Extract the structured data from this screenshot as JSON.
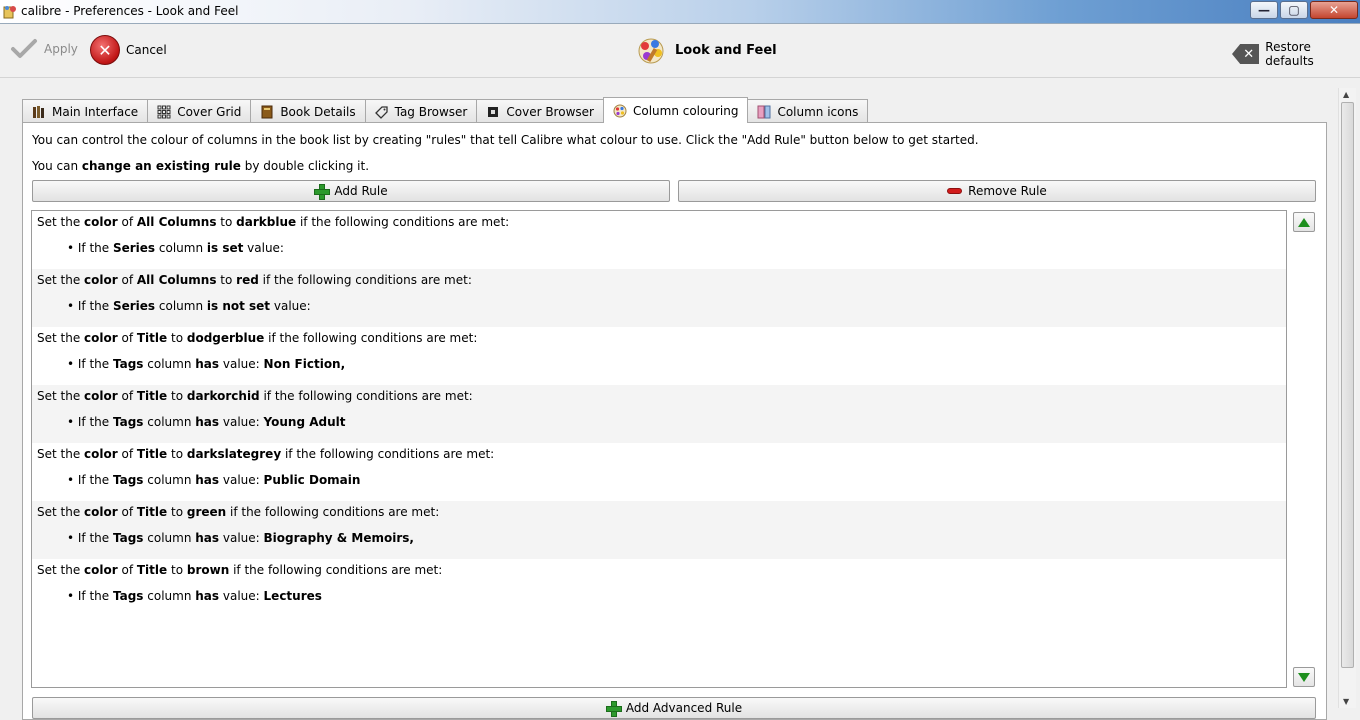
{
  "window": {
    "title": "calibre - Preferences - Look and Feel",
    "minimize": "—",
    "maximize": "▢",
    "close": "✕"
  },
  "toolbar": {
    "apply_label": "Apply",
    "cancel_label": "Cancel",
    "section_title": "Look and Feel",
    "restore_label": "Restore defaults"
  },
  "tabs": [
    {
      "label": "Main Interface",
      "icon": "books-icon"
    },
    {
      "label": "Cover Grid",
      "icon": "grid-icon"
    },
    {
      "label": "Book Details",
      "icon": "book-icon"
    },
    {
      "label": "Tag Browser",
      "icon": "tag-icon"
    },
    {
      "label": "Cover Browser",
      "icon": "cover-icon"
    },
    {
      "label": "Column colouring",
      "icon": "palette-icon",
      "active": true
    },
    {
      "label": "Column icons",
      "icon": "column-icons-icon"
    }
  ],
  "panel": {
    "info_line1": "You can control the colour of columns in the book list by creating \"rules\" that tell Calibre what colour to use. Click the \"Add Rule\" button below to get started.",
    "info_line2_pre": "You can ",
    "info_line2_bold": "change an existing rule",
    "info_line2_post": " by double clicking it.",
    "add_rule": "Add Rule",
    "remove_rule": "Remove Rule",
    "add_advanced_rule": "Add Advanced Rule"
  },
  "rule_text": {
    "set_the": "Set the ",
    "color": "color",
    "of": " of ",
    "to": " to ",
    "conditions": " if the following conditions are met:",
    "bullet_if": "• If the ",
    "column": " column ",
    "value": " value:"
  },
  "rules": [
    {
      "target": "All Columns",
      "color": "darkblue",
      "column": "Series",
      "op": "is set",
      "value": ""
    },
    {
      "target": "All Columns",
      "color": "red",
      "column": "Series",
      "op": "is not set",
      "value": ""
    },
    {
      "target": "Title",
      "color": "dodgerblue",
      "column": "Tags",
      "op": "has",
      "value": "Non Fiction,"
    },
    {
      "target": "Title",
      "color": "darkorchid",
      "column": "Tags",
      "op": "has",
      "value": "Young Adult"
    },
    {
      "target": "Title",
      "color": "darkslategrey",
      "column": "Tags",
      "op": "has",
      "value": "Public Domain"
    },
    {
      "target": "Title",
      "color": "green",
      "column": "Tags",
      "op": "has",
      "value": "Biography & Memoirs,"
    },
    {
      "target": "Title",
      "color": "brown",
      "column": "Tags",
      "op": "has",
      "value": "Lectures"
    }
  ]
}
